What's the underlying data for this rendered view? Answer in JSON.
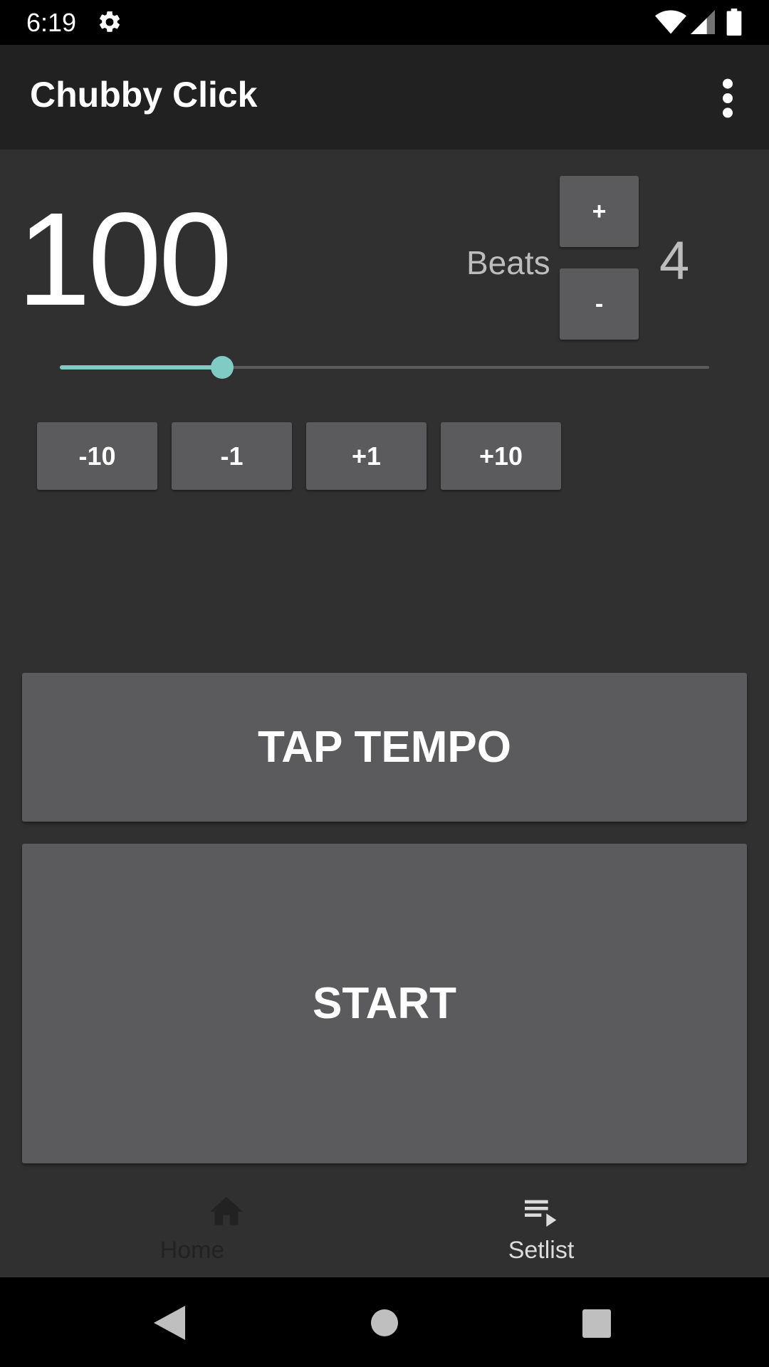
{
  "status_bar": {
    "time": "6:19",
    "icons": [
      "gear-icon",
      "wifi-icon",
      "signal-icon",
      "battery-icon"
    ]
  },
  "app_bar": {
    "title": "Chubby Click",
    "menu_icon": "more-vert-icon"
  },
  "tempo": {
    "bpm": "100",
    "slider_fraction": 0.25,
    "accent_color": "#80cbc4"
  },
  "beats": {
    "label": "Beats",
    "value": "4",
    "plus_label": "+",
    "minus_label": "-"
  },
  "steps": [
    "-10",
    "-1",
    "+1",
    "+10"
  ],
  "buttons": {
    "tap_tempo": "TAP TEMPO",
    "start": "START"
  },
  "bottom_nav": {
    "items": [
      {
        "label": "Home",
        "icon": "home-icon"
      },
      {
        "label": "Setlist",
        "icon": "playlist-icon"
      }
    ]
  },
  "system_nav": [
    "back-icon",
    "home-circle-icon",
    "recents-icon"
  ]
}
